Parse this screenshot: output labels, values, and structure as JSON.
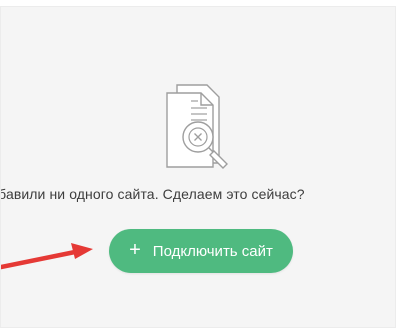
{
  "empty_state": {
    "icon": "document-search-cancel-icon",
    "message": "Вы ещё не добавили ни одного сайта. Сделаем это сейчас?"
  },
  "add_site_button": {
    "icon": "plus-icon",
    "plus": "+",
    "label": "Подключить сайт"
  },
  "colors": {
    "button_bg": "#4fba80",
    "arrow": "#e53935",
    "panel_bg": "#f5f5f5",
    "icon_stroke": "#9e9e9e"
  }
}
